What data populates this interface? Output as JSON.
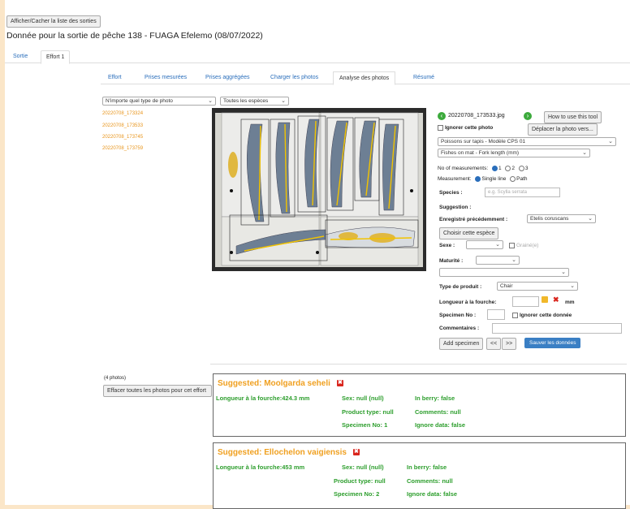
{
  "header": {
    "toggle_button": "Afficher/Cacher la liste des sorties",
    "title": "Donnée pour la sortie de pêche 138 - FUAGA Efelemo (08/07/2022)"
  },
  "top_tabs": [
    "Sortie",
    "Effort 1"
  ],
  "sub_tabs": [
    "Effort",
    "Prises mesurées",
    "Prises aggrégées",
    "Charger les photos",
    "Analyse des photos",
    "Résumé"
  ],
  "filters": {
    "photo_type": "N'importe quel type de photo",
    "species": "Toutes les espèces"
  },
  "photo_list": [
    "20220708_173324",
    "20220708_173533",
    "20220708_173745",
    "20220708_173759"
  ],
  "panel": {
    "photo_name": "20220708_173533.jpg",
    "how_to": "How to use this tool",
    "ignore_photo": "Ignorer cette photo",
    "move_photo": "Déplacer la photo vers...",
    "model": "Poissons sur tapis - Modèle CPS 01",
    "measure_mode": "Fishes on mat - Fork length (mm)",
    "nb_measurements_label": "No of measurements:",
    "nb_options": [
      "1",
      "2",
      "3"
    ],
    "measurement_label": "Measurement:",
    "measurement_options": [
      "Single line",
      "Path"
    ],
    "species_label": "Species :",
    "species_placeholder": "e.g. Scylla serrata",
    "suggestion_label": "Suggestion :",
    "recorded_label": "Enregistré précédemment :",
    "recorded_value": "Etelis coruscans",
    "choose_species": "Choisir cette espèce",
    "sex_label": "Sexe :",
    "gravid_label": "Grainé(e)",
    "maturity_label": "Maturité :",
    "product_label": "Type de produit :",
    "product_value": "Chair",
    "fork_label": "Longueur à la fourche:",
    "fork_unit": "mm",
    "specimen_label": "Specimen No :",
    "ignore_data": "Ignorer cette donnée",
    "comments_label": "Commentaires :",
    "add_specimen": "Add specimen",
    "prev": "<<",
    "next": ">>",
    "save": "Sauver les données"
  },
  "bottom": {
    "count": "(4 photos)",
    "clear_button": "Effacer toutes les photos pour cet effort"
  },
  "cards": [
    {
      "suggested": "Suggested: Moolgarda seheli",
      "length": "Longueur à la fourche:424.3 mm",
      "sex": "Sex:  null (null)",
      "berry": "In berry:  false",
      "product": "Product type:  null",
      "comments": "Comments:  null",
      "specimen": "Specimen No:  1",
      "ignore": "Ignore data:  false"
    },
    {
      "suggested": "Suggested: Ellochelon vaigiensis",
      "length": "Longueur à la fourche:453 mm",
      "sex": "Sex:  null (null)",
      "berry": "In berry:  false",
      "product": "Product type:  null",
      "comments": "Comments:  null",
      "specimen": "Specimen No:  2",
      "ignore": "Ignore data:  false"
    }
  ],
  "colors": {
    "link": "#2a6ebb",
    "photo_link": "#e8941a",
    "suggested": "#f0a020",
    "green": "#2d9e2d",
    "save": "#3a7fc4",
    "danger": "#d9251d",
    "page_bg": "#fbe6c8"
  }
}
